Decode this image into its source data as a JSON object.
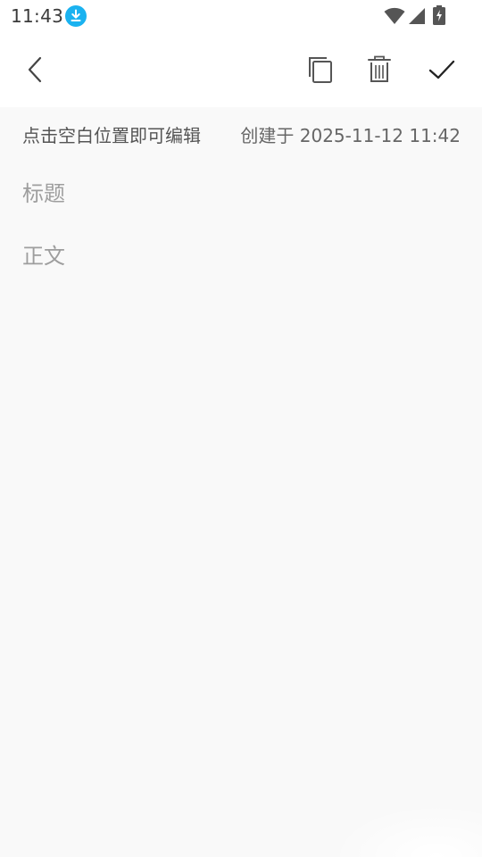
{
  "status_bar": {
    "time": "11:43",
    "icons": [
      "download-icon",
      "wifi-icon",
      "signal-icon",
      "battery-charging-icon"
    ],
    "accent_color": "#1ab2f0"
  },
  "toolbar": {
    "back_icon": "chevron-left-icon",
    "copy_icon": "copy-icon",
    "delete_icon": "trash-icon",
    "done_icon": "check-icon"
  },
  "editor": {
    "hint": "点击空白位置即可编辑",
    "created": "创建于 2025-11-12 11:42",
    "title_placeholder": "标题",
    "body_placeholder": "正文"
  }
}
